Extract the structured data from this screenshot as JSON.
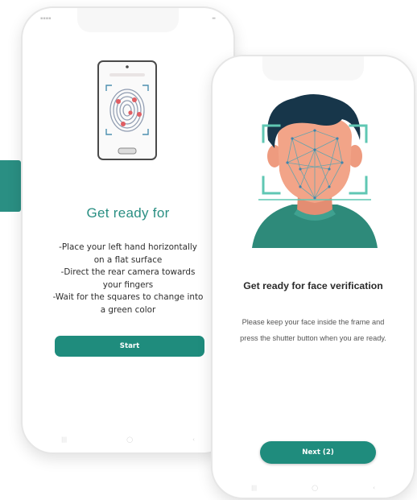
{
  "fingerprint_screen": {
    "title": "Get ready for",
    "instructions": [
      "-Place your left hand horizontally",
      "on a flat surface",
      "-Direct the rear camera towards",
      "your fingers",
      "-Wait for the squares to change into",
      "a green color"
    ],
    "start_label": "Start",
    "illustration": "fingerprint-scan-phone-icon"
  },
  "face_screen": {
    "title": "Get ready for face verification",
    "body": [
      "Please keep your face inside the frame and",
      "press the shutter button when you are ready."
    ],
    "next_label": "Next (2)",
    "illustration": "face-verification-icon"
  },
  "colors": {
    "accent": "#2a8f83",
    "button": "#1f8c7d",
    "hair": "#17364a",
    "skin": "#f2a488",
    "shirt": "#2e8a7a",
    "frame": "#5fc7b3"
  },
  "icons": {
    "nav": [
      "recent-apps-icon",
      "home-icon",
      "back-icon"
    ]
  }
}
